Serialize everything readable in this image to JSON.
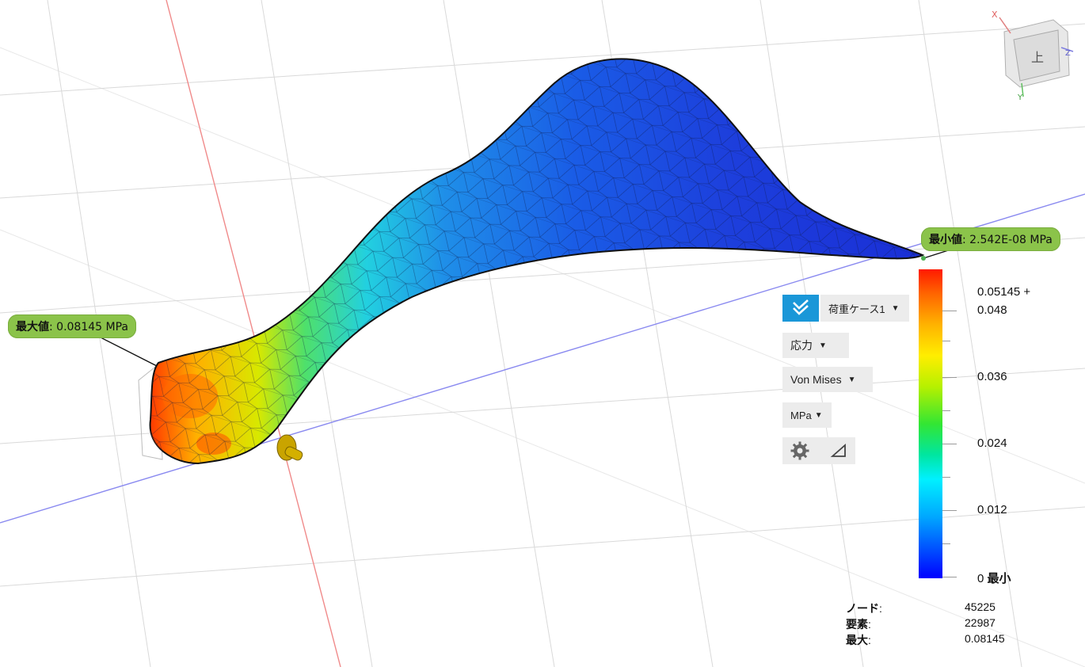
{
  "callouts": {
    "max": {
      "label": "最大値",
      "value": ": 0.08145 MPa"
    },
    "min": {
      "label": "最小値",
      "value": ": 2.542E-08 MPa"
    }
  },
  "controls": {
    "load_case": "荷重ケース1",
    "result_type": "応力",
    "component": "Von Mises",
    "unit": "MPa"
  },
  "legend": {
    "top": "0.05145 +",
    "ticks": [
      "0.048",
      "0.036",
      "0.024",
      "0.012"
    ],
    "bottom_value": "0",
    "bottom_label": "最小",
    "colors": [
      "#ff1a00",
      "#ffee00",
      "#33e633",
      "#00f0ff",
      "#0000ff"
    ]
  },
  "stats": {
    "nodes_label": "ノード",
    "nodes_value": "45225",
    "elements_label": "要素",
    "elements_value": "22987",
    "max_label": "最大",
    "max_value": "0.08145"
  },
  "viewcube": {
    "face_label": "上",
    "axis_x": "X",
    "axis_y": "Y",
    "axis_z": "Z"
  },
  "icons": [
    "check-icon",
    "gear-icon",
    "triangle-icon",
    "pin-constraint-icon"
  ]
}
